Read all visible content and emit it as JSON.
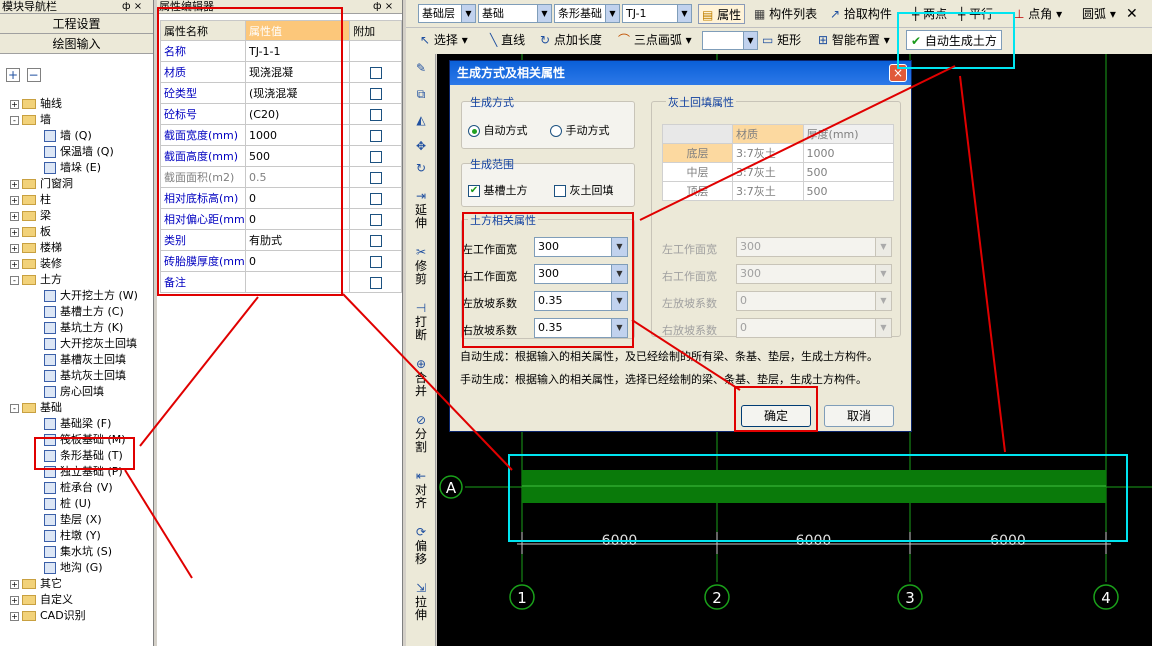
{
  "nav": {
    "title": "模块导航栏",
    "pin": "ф ×",
    "btn_project": "工程设置",
    "btn_drawing": "绘图输入",
    "tree": [
      {
        "label": "轴线",
        "kind": "folder",
        "exp": "+"
      },
      {
        "label": "墙",
        "kind": "folder",
        "exp": "-"
      },
      {
        "label": "墙 (Q)",
        "kind": "item"
      },
      {
        "label": "保温墙 (Q)",
        "kind": "item"
      },
      {
        "label": "墙垛 (E)",
        "kind": "item"
      },
      {
        "label": "门窗洞",
        "kind": "folder",
        "exp": "+"
      },
      {
        "label": "柱",
        "kind": "folder",
        "exp": "+"
      },
      {
        "label": "梁",
        "kind": "folder",
        "exp": "+"
      },
      {
        "label": "板",
        "kind": "folder",
        "exp": "+"
      },
      {
        "label": "楼梯",
        "kind": "folder",
        "exp": "+"
      },
      {
        "label": "装修",
        "kind": "folder",
        "exp": "+"
      },
      {
        "label": "土方",
        "kind": "folder",
        "exp": "-"
      },
      {
        "label": "大开挖土方 (W)",
        "kind": "item"
      },
      {
        "label": "基槽土方 (C)",
        "kind": "item"
      },
      {
        "label": "基坑土方 (K)",
        "kind": "item"
      },
      {
        "label": "大开挖灰土回填",
        "kind": "item"
      },
      {
        "label": "基槽灰土回填",
        "kind": "item"
      },
      {
        "label": "基坑灰土回填",
        "kind": "item"
      },
      {
        "label": "房心回填",
        "kind": "item"
      },
      {
        "label": "基础",
        "kind": "folder",
        "exp": "-"
      },
      {
        "label": "基础梁 (F)",
        "kind": "item"
      },
      {
        "label": "筏板基础 (M)",
        "kind": "item"
      },
      {
        "label": "条形基础 (T)",
        "kind": "item"
      },
      {
        "label": "独立基础 (P)",
        "kind": "item"
      },
      {
        "label": "桩承台 (V)",
        "kind": "item"
      },
      {
        "label": "桩 (U)",
        "kind": "item"
      },
      {
        "label": "垫层 (X)",
        "kind": "item"
      },
      {
        "label": "柱墩 (Y)",
        "kind": "item"
      },
      {
        "label": "集水坑 (S)",
        "kind": "item"
      },
      {
        "label": "地沟 (G)",
        "kind": "item"
      },
      {
        "label": "其它",
        "kind": "folder",
        "exp": "+"
      },
      {
        "label": "自定义",
        "kind": "folder",
        "exp": "+"
      },
      {
        "label": "CAD识别",
        "kind": "folder",
        "exp": "+"
      }
    ]
  },
  "prop": {
    "title": "属性编辑器",
    "pin": "ф ×",
    "h_name": "属性名称",
    "h_value": "属性值",
    "h_extra": "附加",
    "rows": [
      {
        "name": "名称",
        "value": "TJ-1-1",
        "chk": false,
        "gray": false
      },
      {
        "name": "材质",
        "value": "现浇混凝",
        "chk": true,
        "gray": false
      },
      {
        "name": "砼类型",
        "value": "(现浇混凝",
        "chk": true,
        "gray": false
      },
      {
        "name": "砼标号",
        "value": "(C20)",
        "chk": true,
        "gray": false
      },
      {
        "name": "截面宽度(mm)",
        "value": "1000",
        "chk": true,
        "gray": false
      },
      {
        "name": "截面高度(mm)",
        "value": "500",
        "chk": true,
        "gray": false
      },
      {
        "name": "截面面积(m2)",
        "value": "0.5",
        "chk": true,
        "gray": true
      },
      {
        "name": "相对底标高(m)",
        "value": "0",
        "chk": true,
        "gray": false
      },
      {
        "name": "相对偏心距(mm",
        "value": "0",
        "chk": true,
        "gray": false
      },
      {
        "name": "类别",
        "value": "有肋式",
        "chk": true,
        "gray": false
      },
      {
        "name": "砖胎膜厚度(mm",
        "value": "0",
        "chk": true,
        "gray": false
      },
      {
        "name": "备注",
        "value": "",
        "chk": true,
        "gray": false
      }
    ]
  },
  "toolbar1": {
    "floor": "基础层",
    "cat": "基础",
    "type": "条形基础",
    "comp": "TJ-1",
    "attr": "属性",
    "list": "构件列表",
    "pick": "拾取构件",
    "twopt": "两点",
    "parallel": "平行",
    "ptangle": "点角",
    "arc": "圆弧"
  },
  "toolbar2": {
    "select": "选择",
    "line": "直线",
    "ptlen": "点加长度",
    "arc3": "三点画弧",
    "rect": "矩形",
    "smart": "智能布置",
    "auto": "自动生成土方"
  },
  "vtools": [
    "延伸",
    "修剪",
    "打断",
    "合并",
    "分割",
    "对齐",
    "偏移",
    "拉伸"
  ],
  "dialog": {
    "title": "生成方式及相关属性",
    "close": "×",
    "method_title": "生成方式",
    "auto": "自动方式",
    "manual": "手动方式",
    "range_title": "生成范围",
    "range_trench": "基槽土方",
    "range_fill": "灰土回填",
    "earth_title": "土方相关属性",
    "fill_title": "灰土回填属性",
    "earth_fields": [
      {
        "label": "左工作面宽",
        "value": "300"
      },
      {
        "label": "右工作面宽",
        "value": "300"
      },
      {
        "label": "左放坡系数",
        "value": "0.35"
      },
      {
        "label": "右放坡系数",
        "value": "0.35"
      }
    ],
    "fill_fields": [
      {
        "label": "左工作面宽",
        "value": "300"
      },
      {
        "label": "右工作面宽",
        "value": "300"
      },
      {
        "label": "左放坡系数",
        "value": "0"
      },
      {
        "label": "右放坡系数",
        "value": "0"
      }
    ],
    "fill_table": {
      "h_mat": "材质",
      "h_thk": "厚度(mm)",
      "rows": [
        [
          "底层",
          "3:7灰土",
          "1000"
        ],
        [
          "中层",
          "3:7灰土",
          "500"
        ],
        [
          "顶层",
          "3:7灰土",
          "500"
        ]
      ]
    },
    "note1": "自动生成：根据输入的相关属性，及已经绘制的所有梁、条基、垫层，生成土方构件。",
    "note2": "手动生成：根据输入的相关属性，选择已经绘制的梁、条基、垫层，生成土方构件。",
    "ok": "确定",
    "cancel": "取消"
  },
  "canvas": {
    "axis_a": "A",
    "dims": [
      "6000",
      "6000",
      "6000"
    ],
    "axes": [
      "1",
      "2",
      "3",
      "4"
    ],
    "colors": {
      "beam": "#0a7a0a",
      "axis": "#1aa01a",
      "dim": "#c8c8c8"
    }
  }
}
